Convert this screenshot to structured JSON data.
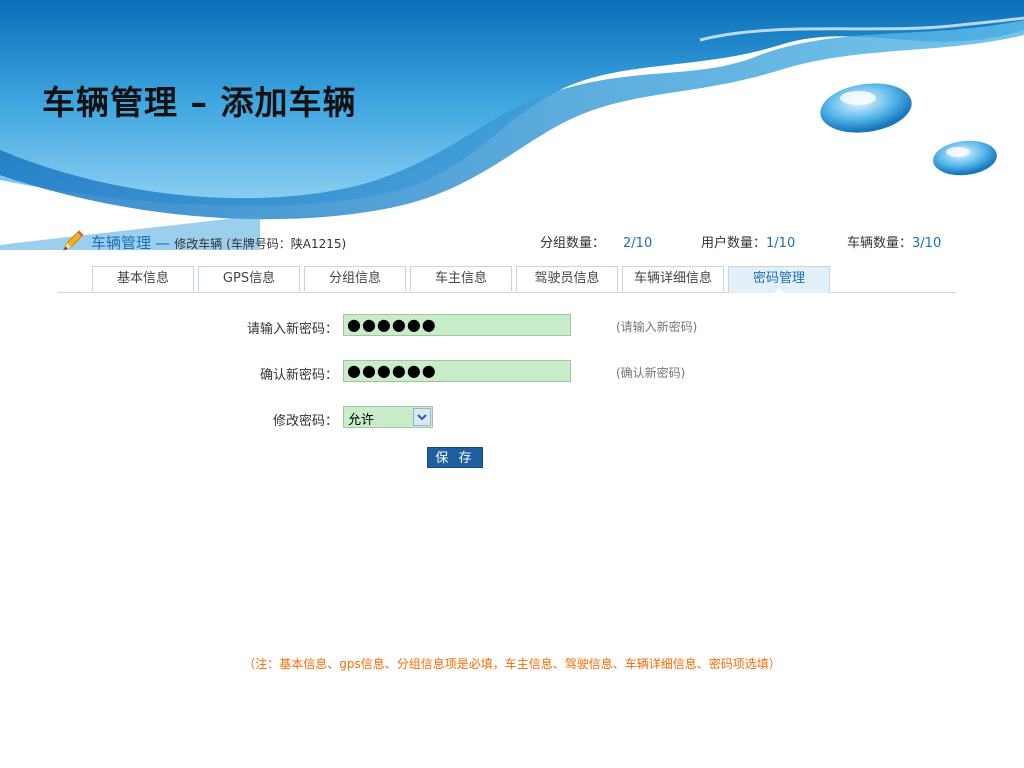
{
  "slide_title": "车辆管理 – 添加车辆",
  "header": {
    "section_link": "车辆管理",
    "dash": "—",
    "page_desc": "修改车辆 (车牌号码：陕A1215)",
    "stats": {
      "groups_label": "分组数量：",
      "groups_value": "2/10",
      "users_label": "用户数量：",
      "users_value": "1/10",
      "vehicles_label": "车辆数量：",
      "vehicles_value": "3/10"
    }
  },
  "tabs": [
    {
      "label": "基本信息",
      "active": false
    },
    {
      "label": "GPS信息",
      "active": false
    },
    {
      "label": "分组信息",
      "active": false
    },
    {
      "label": "车主信息",
      "active": false
    },
    {
      "label": "驾驶员信息",
      "active": false
    },
    {
      "label": "车辆详细信息",
      "active": false
    },
    {
      "label": "密码管理",
      "active": true
    }
  ],
  "form": {
    "new_password_label": "请输入新密码：",
    "new_password_value": "●●●●●●",
    "new_password_hint": "(请输入新密码)",
    "confirm_password_label": "确认新密码：",
    "confirm_password_value": "●●●●●●",
    "confirm_password_hint": "(确认新密码)",
    "modify_label": "修改密码：",
    "modify_selected": "允许",
    "save_label": "保 存"
  },
  "footnote": "（注：基本信息、gps信息、分组信息项是必填，车主信息、驾驶信息、车辆详细信息、密码项选填）",
  "colors": {
    "accent": "#1a6fb5",
    "active_tab_bg": "#e3f0fa",
    "field_bg": "#c9ecc9",
    "save_button": "#1f5f9f",
    "footnote": "#ff6a00"
  }
}
